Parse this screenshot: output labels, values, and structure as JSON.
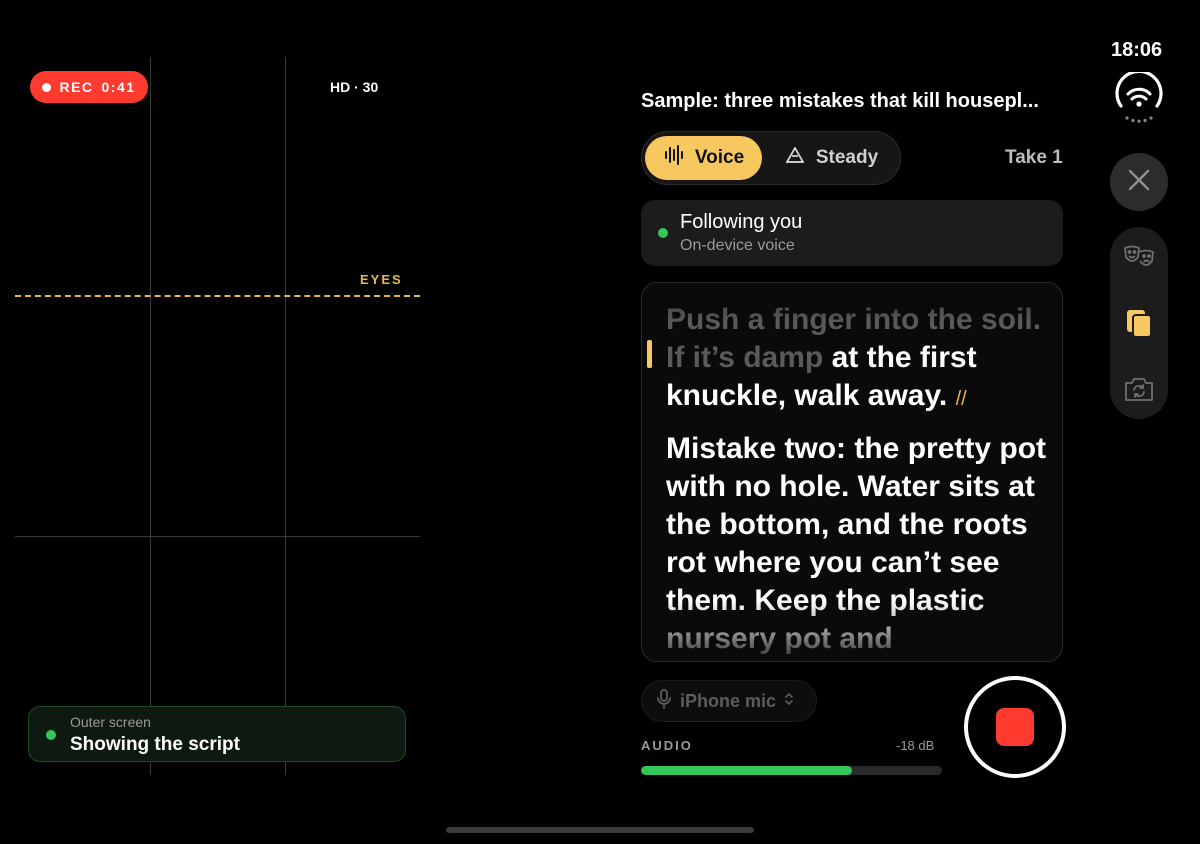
{
  "status": {
    "time": "18:06"
  },
  "viewfinder": {
    "rec_label": "REC",
    "rec_time": "0:41",
    "quality": "HD · 30",
    "eyes_label": "EYES",
    "outer_screen": {
      "label": "Outer screen",
      "status": "Showing the script"
    }
  },
  "session": {
    "title": "Sample: three mistakes that kill housepl...",
    "modes": {
      "voice": "Voice",
      "steady": "Steady",
      "active": "Voice"
    },
    "take": "Take 1"
  },
  "following": {
    "title": "Following you",
    "subtitle": "On-device voice"
  },
  "script": {
    "p1_read_a": "Push a finger into the soil.",
    "p1_read_b": "If it’s damp",
    "p1_unread": " at the first knuckle, walk away.",
    "pause_mark": "//",
    "p2": "Mistake two: the pretty pot with no hole. Water sits at the bottom, and the roots rot where you can’t see them. Keep the plastic nursery pot and"
  },
  "audio": {
    "input": "iPhone mic",
    "label": "AUDIO",
    "level": "-18 dB",
    "meter_fraction": 0.7
  },
  "colors": {
    "accent": "#f6c85f",
    "record": "#ff3b30",
    "live": "#34c759"
  },
  "icons": [
    "waveform-icon",
    "level-icon",
    "wifi-icon",
    "close-icon",
    "masks-icon",
    "copy-icon",
    "flip-camera-icon",
    "mic-icon",
    "chevron-updown-icon"
  ]
}
